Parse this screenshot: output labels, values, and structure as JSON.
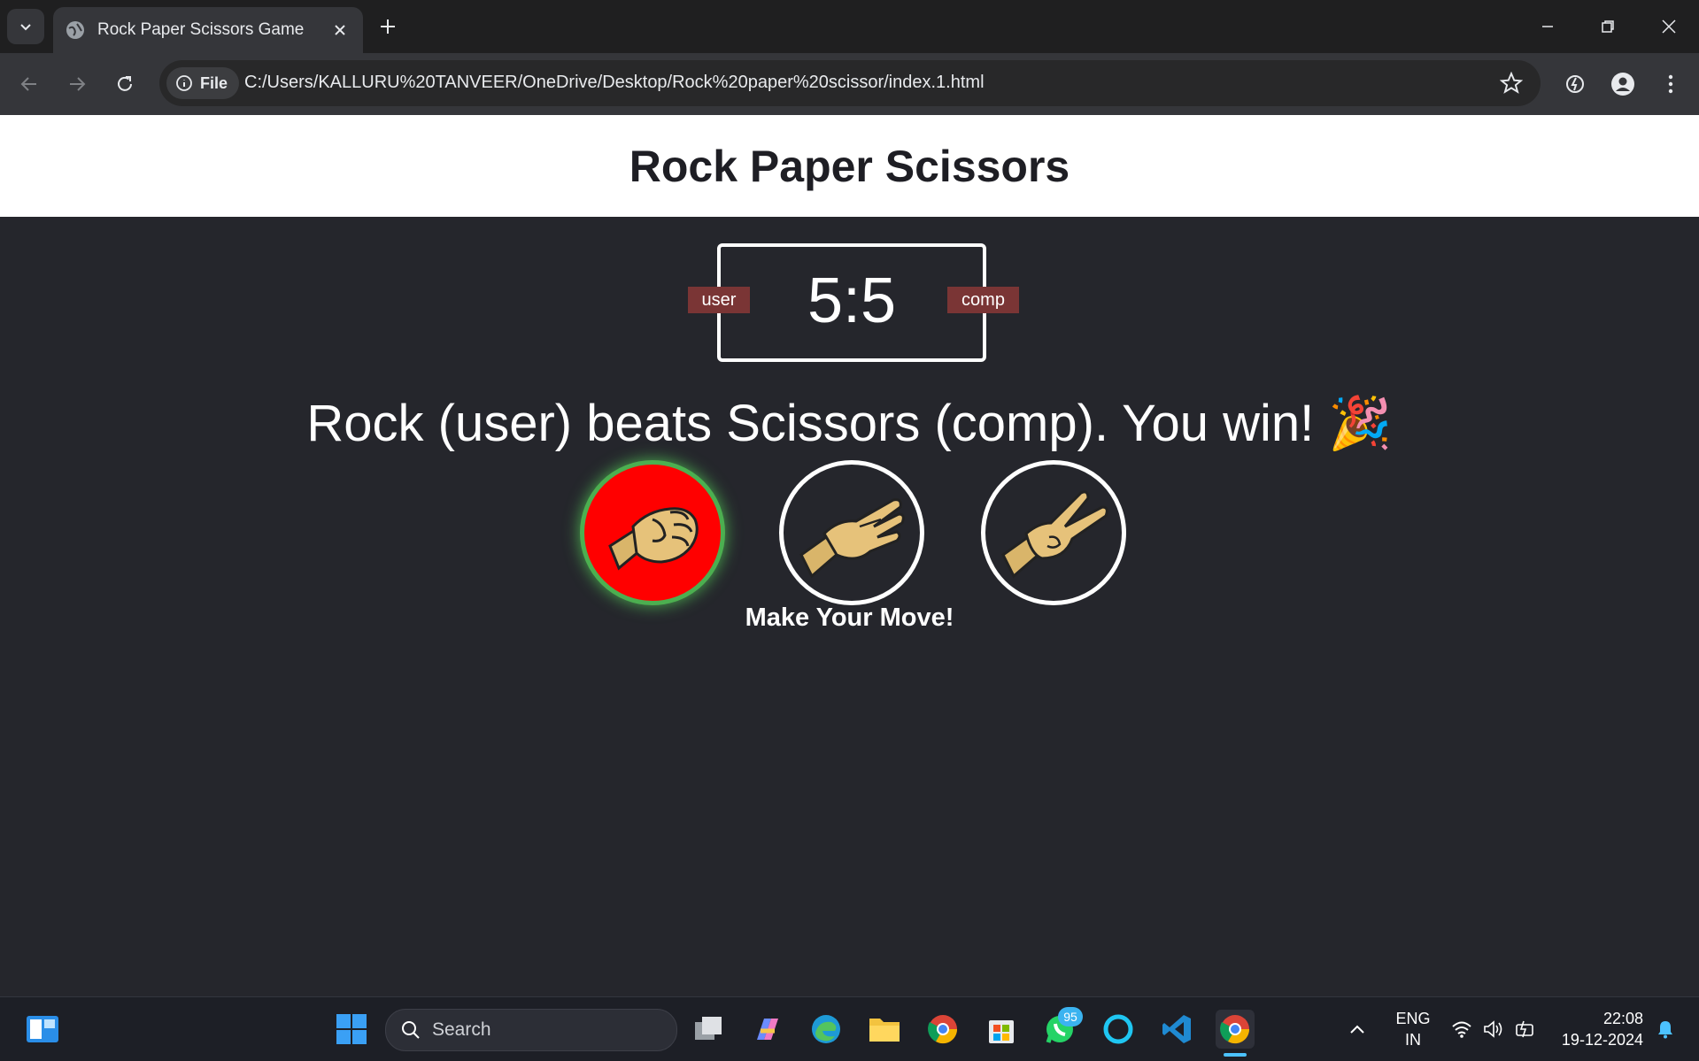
{
  "browser": {
    "tab_title": "Rock Paper Scissors Game",
    "site_chip": "File",
    "url": "C:/Users/KALLURU%20TANVEER/OneDrive/Desktop/Rock%20paper%20scissor/index.1.html"
  },
  "page": {
    "title": "Rock Paper Scissors",
    "score": "5:5",
    "user_label": "user",
    "comp_label": "comp",
    "result": "Rock (user) beats Scissors (comp). You win! 🎉",
    "move_prompt": "Make Your Move!",
    "choices": [
      "rock",
      "paper",
      "scissors"
    ],
    "selected_choice": "rock",
    "colors": {
      "win_bg": "#ff0000",
      "win_glow": "#4caf50",
      "badge": "#7a3535",
      "page_bg": "#25262c"
    }
  },
  "taskbar": {
    "search_placeholder": "Search",
    "whatsapp_badge": "95",
    "lang_top": "ENG",
    "lang_bottom": "IN",
    "time": "22:08",
    "date": "19-12-2024"
  }
}
